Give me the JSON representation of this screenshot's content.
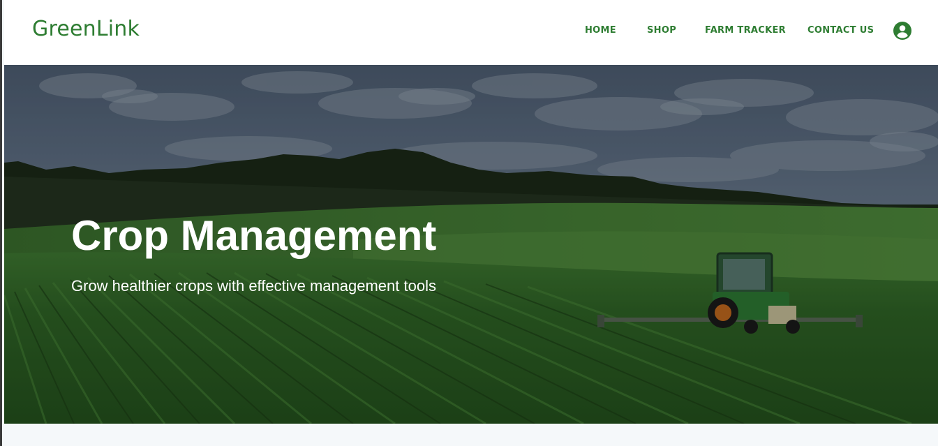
{
  "brand": {
    "name": "GreenLink",
    "color": "#2e7d32"
  },
  "nav": {
    "items": [
      {
        "label": "HOME"
      },
      {
        "label": "SHOP"
      },
      {
        "label": "FARM TRACKER"
      },
      {
        "label": "CONTACT US"
      }
    ],
    "account_icon": "account-circle-icon"
  },
  "hero": {
    "title": "Crop Management",
    "subtitle": "Grow healthier crops with effective management tools",
    "image": "tractor-in-crop-field"
  },
  "colors": {
    "accent": "#2e7d32",
    "page_background": "#f5f8fa"
  }
}
